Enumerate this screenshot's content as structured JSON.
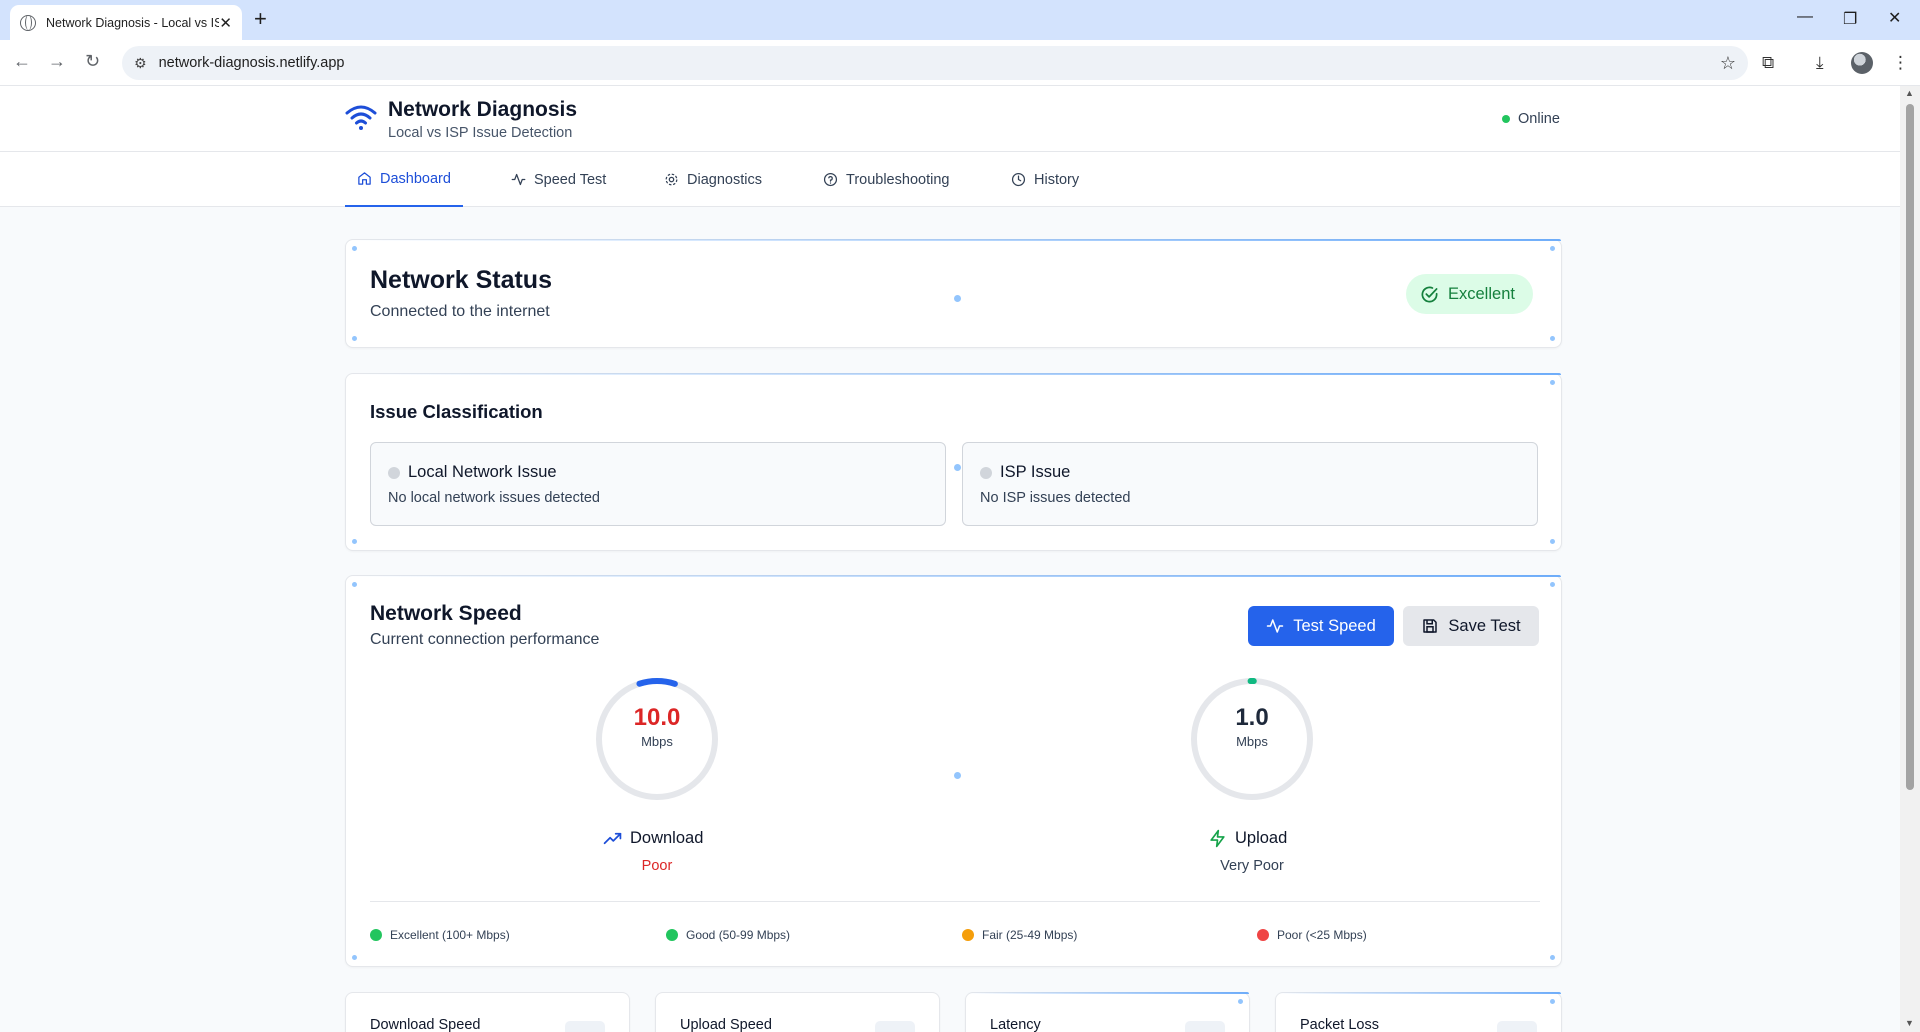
{
  "browser": {
    "tab_title": "Network Diagnosis - Local vs IS",
    "url": "network-diagnosis.netlify.app"
  },
  "header": {
    "title": "Network Diagnosis",
    "subtitle": "Local vs ISP Issue Detection",
    "status": "Online"
  },
  "nav": {
    "items": [
      {
        "label": "Dashboard",
        "icon": "home-icon",
        "active": true
      },
      {
        "label": "Speed Test",
        "icon": "activity-icon"
      },
      {
        "label": "Diagnostics",
        "icon": "gear-icon"
      },
      {
        "label": "Troubleshooting",
        "icon": "help-circle-icon"
      },
      {
        "label": "History",
        "icon": "clock-icon"
      }
    ]
  },
  "network_status": {
    "title": "Network Status",
    "subtitle": "Connected to the internet",
    "badge": "Excellent"
  },
  "issue_classification": {
    "title": "Issue Classification",
    "local": {
      "title": "Local Network Issue",
      "message": "No local network issues detected"
    },
    "isp": {
      "title": "ISP Issue",
      "message": "No ISP issues detected"
    }
  },
  "network_speed": {
    "title": "Network Speed",
    "subtitle": "Current connection performance",
    "test_button": "Test Speed",
    "save_button": "Save Test",
    "download": {
      "value": "10.0",
      "unit": "Mbps",
      "label": "Download",
      "rating": "Poor",
      "fraction": 0.1
    },
    "upload": {
      "value": "1.0",
      "unit": "Mbps",
      "label": "Upload",
      "rating": "Very Poor",
      "fraction": 0.01
    },
    "legend": [
      {
        "label": "Excellent (100+ Mbps)",
        "color": "#22c55e"
      },
      {
        "label": "Good (50-99 Mbps)",
        "color": "#22c55e"
      },
      {
        "label": "Fair (25-49 Mbps)",
        "color": "#f59e0b"
      },
      {
        "label": "Poor (<25 Mbps)",
        "color": "#ef4444"
      }
    ]
  },
  "metrics": [
    {
      "label": "Download Speed"
    },
    {
      "label": "Upload Speed"
    },
    {
      "label": "Latency"
    },
    {
      "label": "Packet Loss"
    }
  ],
  "colors": {
    "accent": "#2563eb",
    "success": "#16a34a",
    "poor": "#dc2626"
  }
}
